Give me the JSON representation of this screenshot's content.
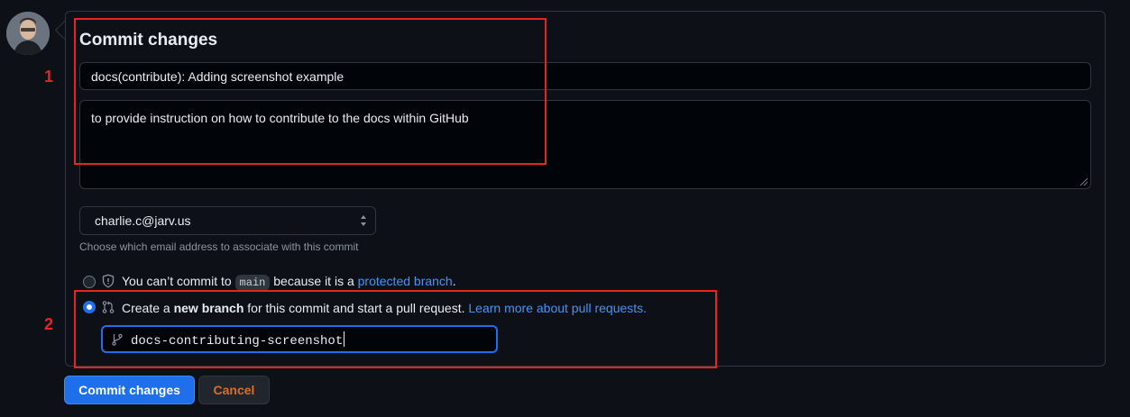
{
  "form": {
    "title": "Commit changes",
    "summary_value": "docs(contribute): Adding screenshot example",
    "description_value": "to provide instruction on how to contribute to the docs within GitHub",
    "email_selected": "charlie.c@jarv.us",
    "email_note": "Choose which email address to associate with this commit"
  },
  "options": {
    "direct": {
      "prefix": "You can’t commit to",
      "branch": "main",
      "middle": "because it is a",
      "link": "protected branch",
      "suffix": ".",
      "selected": false
    },
    "new_branch": {
      "prefix": "Create a",
      "bold": "new branch",
      "middle": "for this commit and start a pull request.",
      "link": "Learn more about pull requests.",
      "selected": true
    }
  },
  "branch_name": "docs-contributing-screenshot",
  "buttons": {
    "commit": "Commit changes",
    "cancel": "Cancel"
  },
  "annotations": [
    "1",
    "2"
  ],
  "colors": {
    "accent": "#1f6feb",
    "link": "#4493f8",
    "annotation": "#e5251f",
    "cancel": "#db6d28"
  },
  "icons": [
    "avatar",
    "shield-icon",
    "pull-request-icon",
    "git-branch-icon",
    "select-caret-icon",
    "resize-grip-icon"
  ]
}
